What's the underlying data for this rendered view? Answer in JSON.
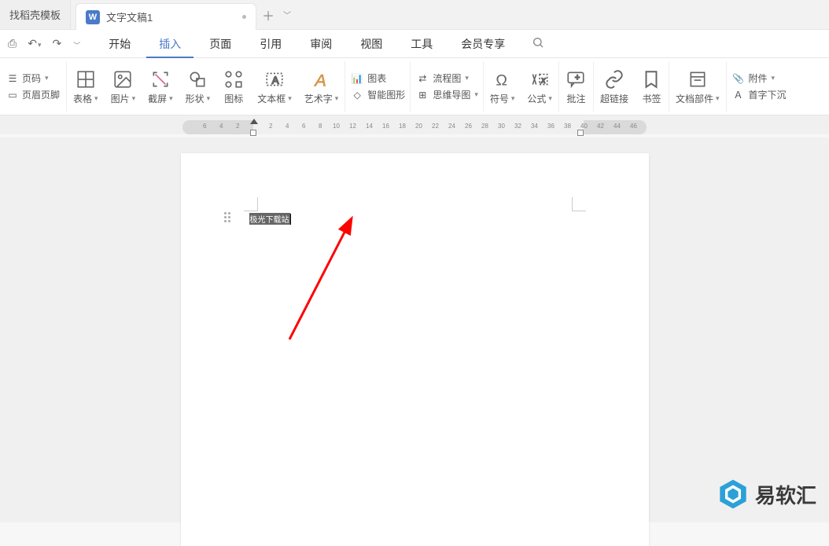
{
  "tabs": {
    "template_tab": "找稻壳模板",
    "doc_tab": "文字文稿1",
    "doc_icon_letter": "W"
  },
  "menubar": {
    "items": [
      "开始",
      "插入",
      "页面",
      "引用",
      "审阅",
      "视图",
      "工具",
      "会员专享"
    ],
    "active_index": 1
  },
  "ribbon": {
    "page_number": "页码",
    "header_footer": "页眉页脚",
    "table": "表格",
    "picture": "图片",
    "screenshot": "截屏",
    "shapes": "形状",
    "icons": "图标",
    "textbox": "文本框",
    "wordart": "艺术字",
    "chart": "图表",
    "smartart": "智能图形",
    "flowchart": "流程图",
    "mindmap": "思维导图",
    "symbol": "符号",
    "equation": "公式",
    "comment": "批注",
    "hyperlink": "超链接",
    "bookmark": "书签",
    "docparts": "文档部件",
    "attachment": "附件",
    "dropcap": "首字下沉"
  },
  "ruler": {
    "left_numbers": [
      "6",
      "4",
      "2"
    ],
    "right_numbers": [
      "2",
      "4",
      "6",
      "8",
      "10",
      "12",
      "14",
      "16",
      "18",
      "20",
      "22",
      "24",
      "26",
      "28",
      "30",
      "32",
      "34",
      "36",
      "38",
      "40",
      "42",
      "44",
      "46"
    ]
  },
  "document": {
    "typed_text": "极光下载站"
  },
  "watermark": {
    "text": "易软汇"
  }
}
